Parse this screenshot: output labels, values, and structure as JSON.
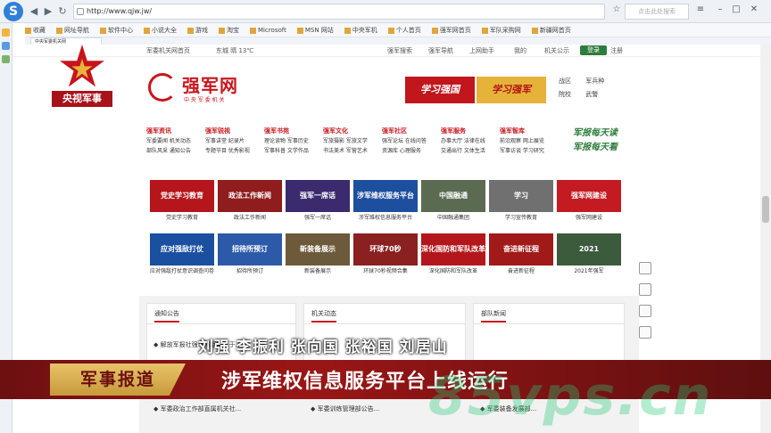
{
  "browser": {
    "url": "http://www.qjw.jw/",
    "search_placeholder": "点击此处搜索",
    "bookmarks": [
      "收藏",
      "网址导航",
      "软件中心",
      "小说大全",
      "游戏",
      "淘宝",
      "Microsoft",
      "MSN 网站",
      "中央军机",
      "个人首页",
      "强军网首页",
      "军队采购网",
      "新疆网首页"
    ],
    "tab_label": "中央军委机关网"
  },
  "topnav": {
    "home": "军委机关网首页",
    "weather": "东城 晴 13℃",
    "links": [
      "强军搜索",
      "强军导航",
      "上网助手",
      "我的",
      "机关公示"
    ],
    "login": "登录",
    "register": "注册"
  },
  "header": {
    "cctv_label": "央视军事",
    "site_name": "强军网",
    "site_sub": "中 央 军 委 机 关",
    "banner1": "学习强国",
    "banner2": "学习强军",
    "right_links": [
      "战区",
      "军兵种",
      "院校",
      "武警"
    ]
  },
  "menu": [
    {
      "head": "强军资讯",
      "items": [
        "军委要闻 机关动态",
        "部队风采 通知公告"
      ]
    },
    {
      "head": "强军锐视",
      "items": [
        "军事讲堂 纪录片",
        "专题节目 优秀影视"
      ]
    },
    {
      "head": "强军书苑",
      "items": [
        "理论读物 军事历史",
        "军事科普 文学作品"
      ]
    },
    {
      "head": "强军文化",
      "items": [
        "军旅摄影 军旅文学",
        "书法美术 军营艺术"
      ]
    },
    {
      "head": "强军社区",
      "items": [
        "强军论坛 在线问答",
        "资源库 心理服务"
      ]
    },
    {
      "head": "强军服务",
      "items": [
        "办事大厅 法律在线",
        "交通出行 文体生活"
      ]
    },
    {
      "head": "强军智库",
      "items": [
        "前沿观察 网上展览",
        "军事访谈 学习研究"
      ]
    }
  ],
  "slogan": [
    "军报每天读",
    "军报每天看"
  ],
  "tiles": [
    {
      "title": "党史学习教育",
      "cap": "党史学习教育",
      "color": "#b5161b"
    },
    {
      "title": "政法工作新闻",
      "cap": "政法工作新闻",
      "color": "#8f1d1d"
    },
    {
      "title": "强军一席话",
      "cap": "强军一席话",
      "color": "#3b2b6e"
    },
    {
      "title": "涉军维权服务平台",
      "cap": "涉军维权信息服务平台",
      "color": "#1d4f9e"
    },
    {
      "title": "中国融通",
      "cap": "中国融通集团",
      "color": "#5a6b52"
    },
    {
      "title": "学习",
      "cap": "学习宣传教育",
      "color": "#707070"
    },
    {
      "title": "强军网建设",
      "cap": "强军网建设",
      "color": "#c41b22"
    },
    {
      "title": "应对强敌打仗",
      "cap": "应对强敌打仗意识调查问卷",
      "color": "#1b4fa0"
    },
    {
      "title": "招待所预订",
      "cap": "招待所预订",
      "color": "#2c5aa8"
    },
    {
      "title": "新装备展示",
      "cap": "新装备展示",
      "color": "#6c5a3a"
    },
    {
      "title": "环球70秒",
      "cap": "环球70秒视频合集",
      "color": "#8a2020"
    },
    {
      "title": "深化国防和军队改革",
      "cap": "深化国防和军队改革",
      "color": "#b3171c"
    },
    {
      "title": "奋进新征程",
      "cap": "奋进新征程",
      "color": "#a01a1a"
    },
    {
      "title": "2021",
      "cap": "2021年强军",
      "color": "#3c5a3c"
    }
  ],
  "sections": [
    "通知公告",
    "机关动态",
    "部队新闻"
  ],
  "news": [
    "◆ 解放军报社强军网活动已于...",
    "◆ 军委政治工作部直属机关社...",
    "◆ 军委训练管理部公告...",
    "◆ 军委装备发展部..."
  ],
  "overlay": {
    "names_line": "刘强 李振利 张向国 张裕国 刘居山",
    "tv_label": "军事报道",
    "tv_title": "涉军维权信息服务平台上线运行",
    "watermark": "85vps.cn"
  },
  "colors": {
    "accent": "#c9161d",
    "green": "#2e7d3c",
    "gold": "#e8c36a"
  }
}
